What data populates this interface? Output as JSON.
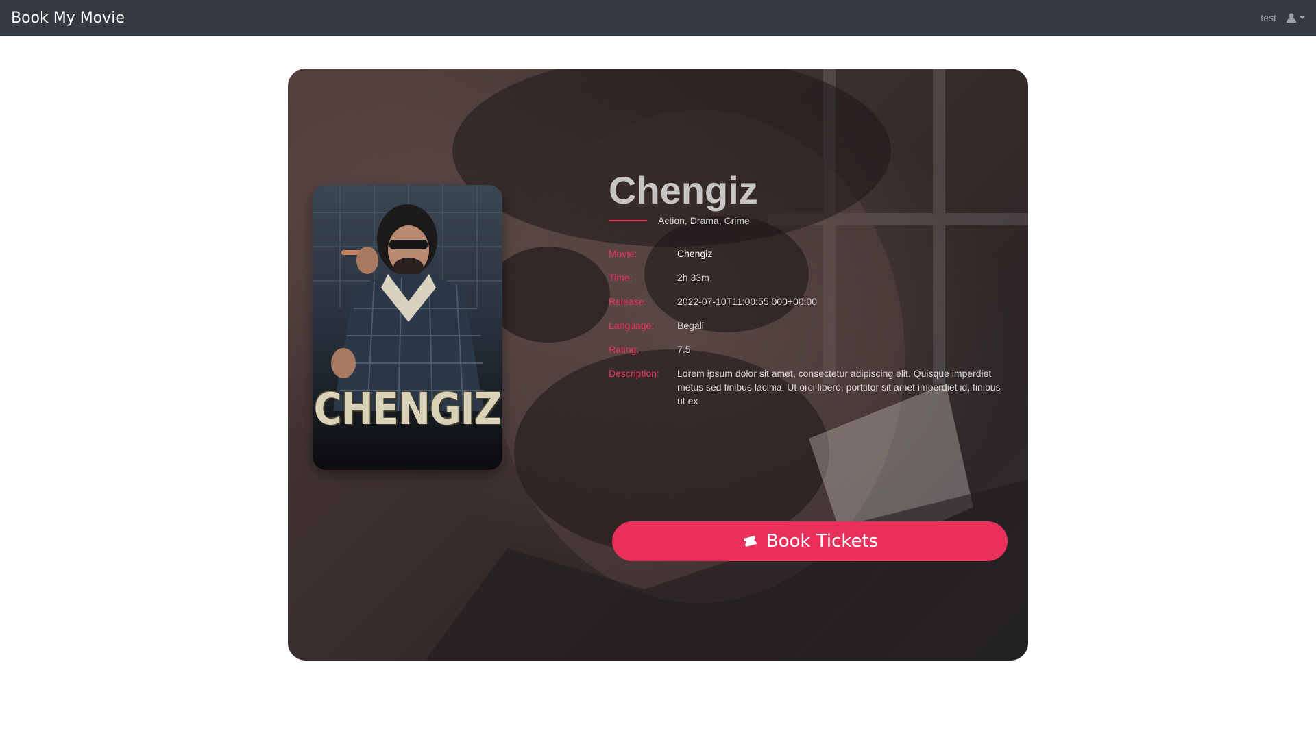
{
  "navbar": {
    "brand": "Book My Movie",
    "username": "test",
    "user_icon": "user-icon"
  },
  "movie": {
    "title": "Chengiz",
    "genres": "Action, Drama, Crime",
    "poster_text": "CHENGIZ",
    "details": [
      {
        "label": "Movie:",
        "value": "Chengiz"
      },
      {
        "label": "Time:",
        "value": "2h 33m"
      },
      {
        "label": "Release:",
        "value": "2022-07-10T11:00:55.000+00:00"
      },
      {
        "label": "Language:",
        "value": "Begali"
      },
      {
        "label": "Rating:",
        "value": "7.5"
      },
      {
        "label": "Description:",
        "value": "Lorem ipsum dolor sit amet, consectetur adipiscing elit. Quisque imperdiet metus sed finibus lacinia. Ut orci libero, porttitor sit amet imperdiet id, finibus ut ex"
      }
    ]
  },
  "actions": {
    "book_label": "Book Tickets",
    "book_icon": "ticket-icon"
  },
  "colors": {
    "accent": "#e8305a",
    "navbar": "#343a40"
  }
}
